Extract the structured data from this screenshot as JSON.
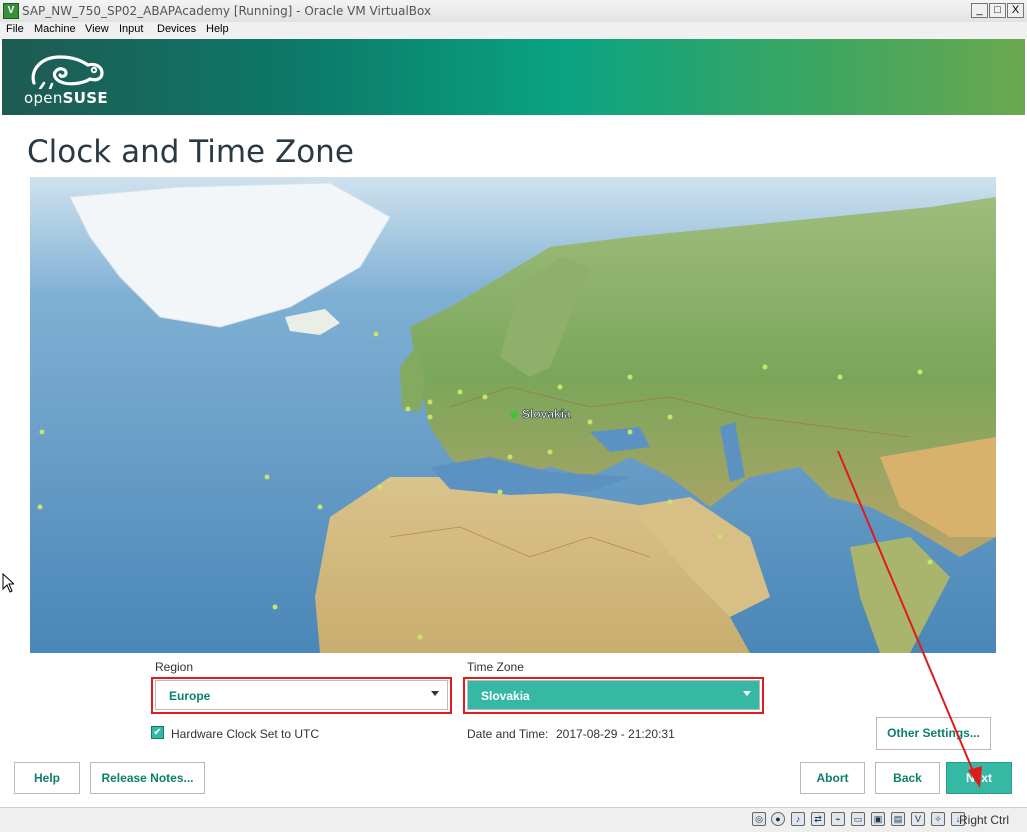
{
  "window": {
    "title": "SAP_NW_750_SP02_ABAPAcademy [Running] - Oracle VM VirtualBox",
    "minimize": "_",
    "maximize": "□",
    "close": "X"
  },
  "menu": [
    "File",
    "Machine",
    "View",
    "Input",
    "Devices",
    "Help"
  ],
  "brand": {
    "prefix": "open",
    "name": "SUSE"
  },
  "page_title": "Clock and Time Zone",
  "map": {
    "selected_label": "Slovakia"
  },
  "region": {
    "label": "Region",
    "value": "Europe"
  },
  "timezone": {
    "label": "Time Zone",
    "value": "Slovakia"
  },
  "hardware_clock": {
    "label": "Hardware Clock Set to UTC",
    "checked": true
  },
  "datetime": {
    "label": "Date and Time:",
    "value": "2017-08-29 - 21:20:31"
  },
  "buttons": {
    "other_settings": "Other Settings...",
    "help": "Help",
    "release_notes": "Release Notes...",
    "abort": "Abort",
    "back": "Back",
    "next": "Next"
  },
  "statusbar": {
    "host_key": "Right Ctrl"
  },
  "colors": {
    "accent": "#35b9a5",
    "accent_text": "#0c7f6d",
    "highlight": "#e01b1b"
  }
}
